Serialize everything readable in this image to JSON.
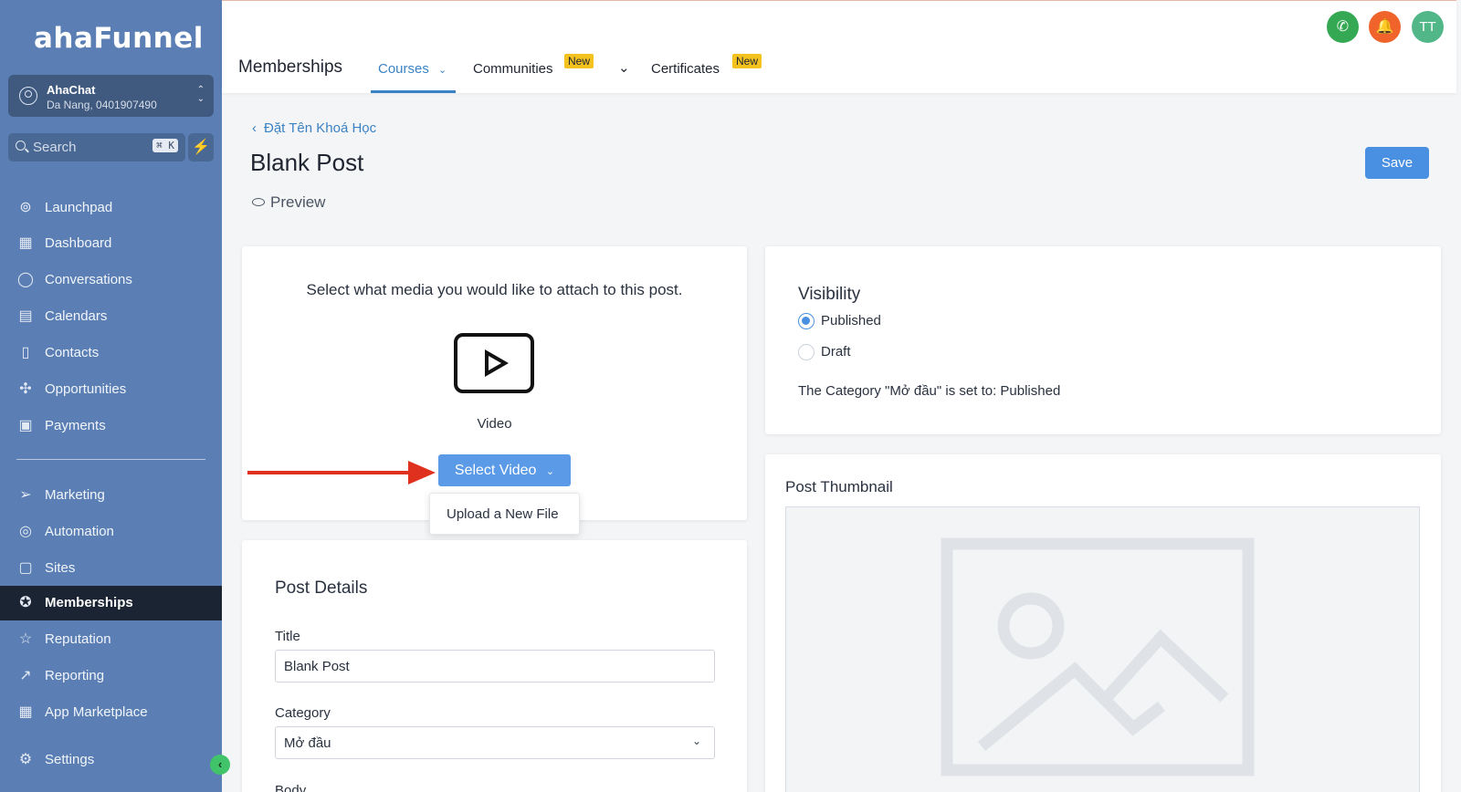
{
  "sidebar": {
    "logo": "ahaFunnel",
    "account": {
      "name": "AhaChat",
      "location": "Da Nang, 0401907490"
    },
    "search": {
      "placeholder": "Search",
      "shortcut": "⌘ K"
    },
    "items": [
      {
        "label": "Launchpad",
        "icon": "rocket-icon"
      },
      {
        "label": "Dashboard",
        "icon": "grid-icon"
      },
      {
        "label": "Conversations",
        "icon": "chat-bubble-icon"
      },
      {
        "label": "Calendars",
        "icon": "calendar-icon"
      },
      {
        "label": "Contacts",
        "icon": "contact-book-icon"
      },
      {
        "label": "Opportunities",
        "icon": "network-icon"
      },
      {
        "label": "Payments",
        "icon": "receipt-icon"
      },
      {
        "label": "Marketing",
        "icon": "paper-plane-icon"
      },
      {
        "label": "Automation",
        "icon": "automation-icon"
      },
      {
        "label": "Sites",
        "icon": "globe-box-icon"
      },
      {
        "label": "Memberships",
        "icon": "badge-icon",
        "active": true
      },
      {
        "label": "Reputation",
        "icon": "star-icon"
      },
      {
        "label": "Reporting",
        "icon": "trend-icon"
      },
      {
        "label": "App Marketplace",
        "icon": "apps-grid-icon"
      },
      {
        "label": "Settings",
        "icon": "gear-icon"
      }
    ]
  },
  "topbar": {
    "title": "Memberships",
    "tabs": [
      {
        "label": "Courses",
        "active": true
      },
      {
        "label": "Communities",
        "badge": "New"
      },
      {
        "label": "Certificates",
        "badge": "New"
      }
    ],
    "user_initials": "TT",
    "colors": {
      "phone": "#34a853",
      "bell": "#f0642c",
      "avatar": "#52b788"
    }
  },
  "page": {
    "breadcrumb": "Đặt Tên Khoá Học",
    "title": "Blank Post",
    "preview_label": "Preview",
    "save_label": "Save"
  },
  "media": {
    "prompt": "Select what media you would like to attach to this post.",
    "video_label": "Video",
    "select_button": "Select Video",
    "dropdown_option": "Upload a New File"
  },
  "details": {
    "heading": "Post Details",
    "title_label": "Title",
    "title_value": "Blank Post",
    "category_label": "Category",
    "category_value": "Mở đầu",
    "body_label": "Body"
  },
  "visibility": {
    "heading": "Visibility",
    "options": [
      {
        "label": "Published",
        "selected": true
      },
      {
        "label": "Draft",
        "selected": false
      }
    ],
    "note": "The Category \"Mở đầu\" is set to: Published"
  },
  "thumbnail": {
    "heading": "Post Thumbnail"
  }
}
